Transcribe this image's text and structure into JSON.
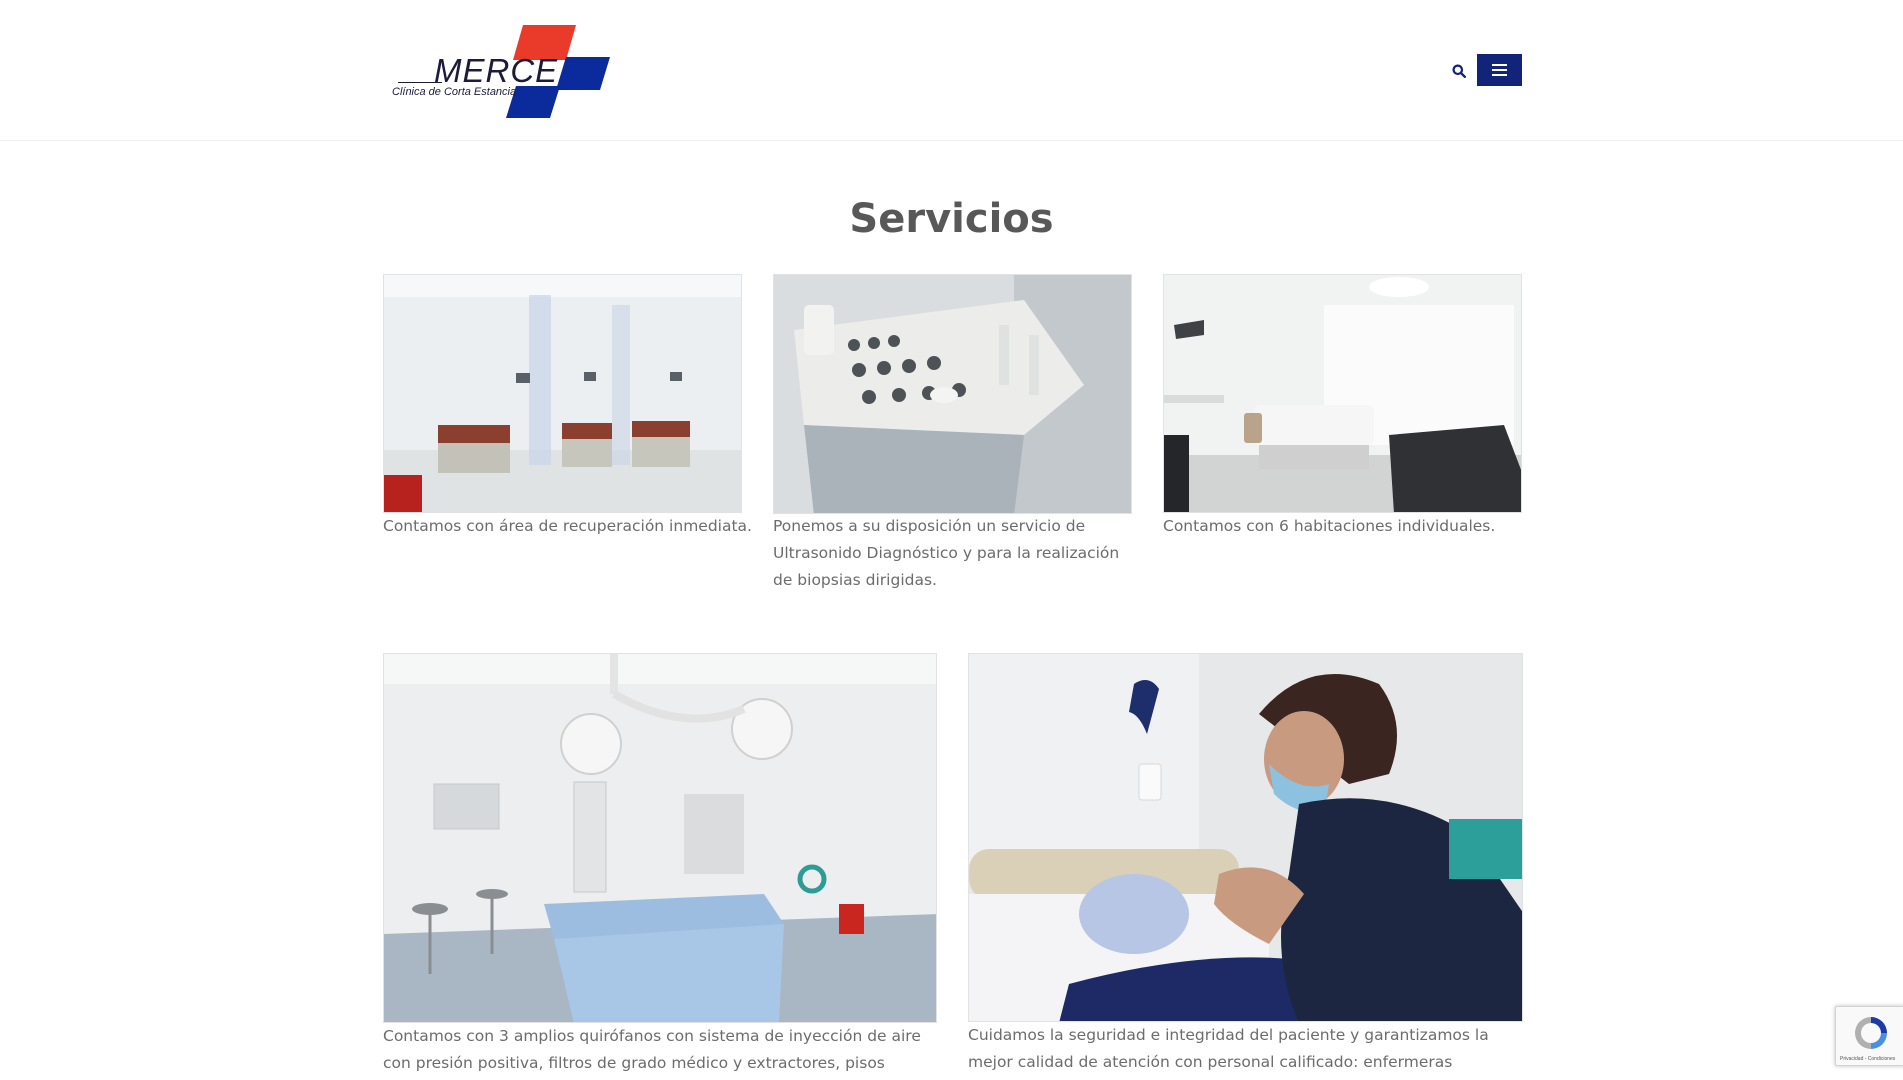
{
  "brand": {
    "name": "MERCE",
    "tagline": "Clínica de Corta Estancia",
    "red": "#ea3a2a",
    "blue": "#0b2a9c"
  },
  "header": {
    "search_icon": "search-icon",
    "menu_icon": "hamburger-menu-icon",
    "menu_color": "#11247a"
  },
  "page": {
    "title": "Servicios"
  },
  "services": [
    {
      "image": "recovery-area-photo",
      "caption": "Contamos con área de recuperación inmediata."
    },
    {
      "image": "ultrasound-machine-photo",
      "caption": "Ponemos a su disposición un servicio de Ultrasonido Diagnóstico y para la realización de biopsias dirigidas."
    },
    {
      "image": "individual-room-photo",
      "caption": "Contamos con 6 habitaciones individuales."
    },
    {
      "image": "operating-room-photo",
      "caption": "Contamos con 3 amplios quirófanos con sistema de inyección de aire con presión positiva, filtros de grado médico y extractores, pisos conductivos,"
    },
    {
      "image": "nurse-patient-photo",
      "caption": "Cuidamos la seguridad e integridad del paciente y garantizamos la mejor calidad de atención con personal calificado: enfermeras instrumentistas,"
    }
  ],
  "recaptcha": {
    "label": "Privacidad - Condiciones"
  }
}
